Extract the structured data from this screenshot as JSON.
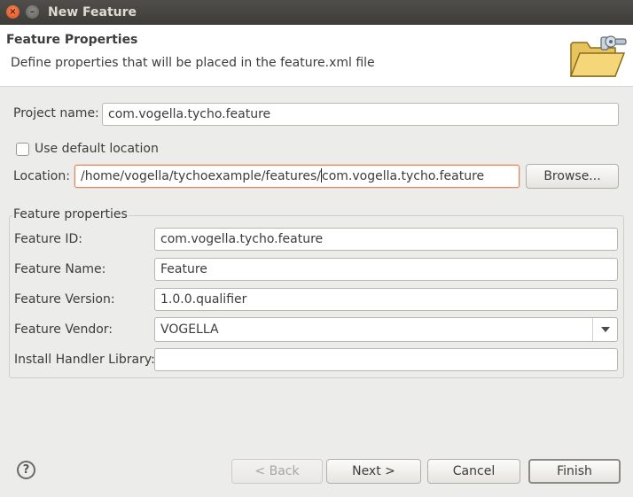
{
  "window": {
    "title": "New Feature",
    "close_glyph": "×",
    "minimize_glyph": "–"
  },
  "header": {
    "title": "Feature Properties",
    "description": "Define properties that will be placed in the feature.xml file",
    "icon": "folder-icon"
  },
  "project": {
    "label": "Project name:",
    "value": "com.vogella.tycho.feature"
  },
  "use_default_location": {
    "label": "Use default location",
    "checked": false
  },
  "location": {
    "label": "Location:",
    "value_before_caret": "/home/vogella/tychoexample/features/",
    "value_after_caret": "com.vogella.tycho.feature",
    "browse_label": "Browse..."
  },
  "feature_properties": {
    "group_title": "Feature properties",
    "id_label": "Feature ID:",
    "id_value": "com.vogella.tycho.feature",
    "name_label": "Feature Name:",
    "name_value": "Feature",
    "version_label": "Feature Version:",
    "version_value": "1.0.0.qualifier",
    "vendor_label": "Feature Vendor:",
    "vendor_value": "VOGELLA",
    "handler_label": "Install Handler Library:",
    "handler_value": ""
  },
  "footer": {
    "help_glyph": "?",
    "back_label": "< Back",
    "next_label": "Next >",
    "cancel_label": "Cancel",
    "finish_label": "Finish"
  },
  "colors": {
    "accent_focus": "#e98358",
    "titlebar": "#3d3c38",
    "dialog_bg": "#ececea"
  }
}
